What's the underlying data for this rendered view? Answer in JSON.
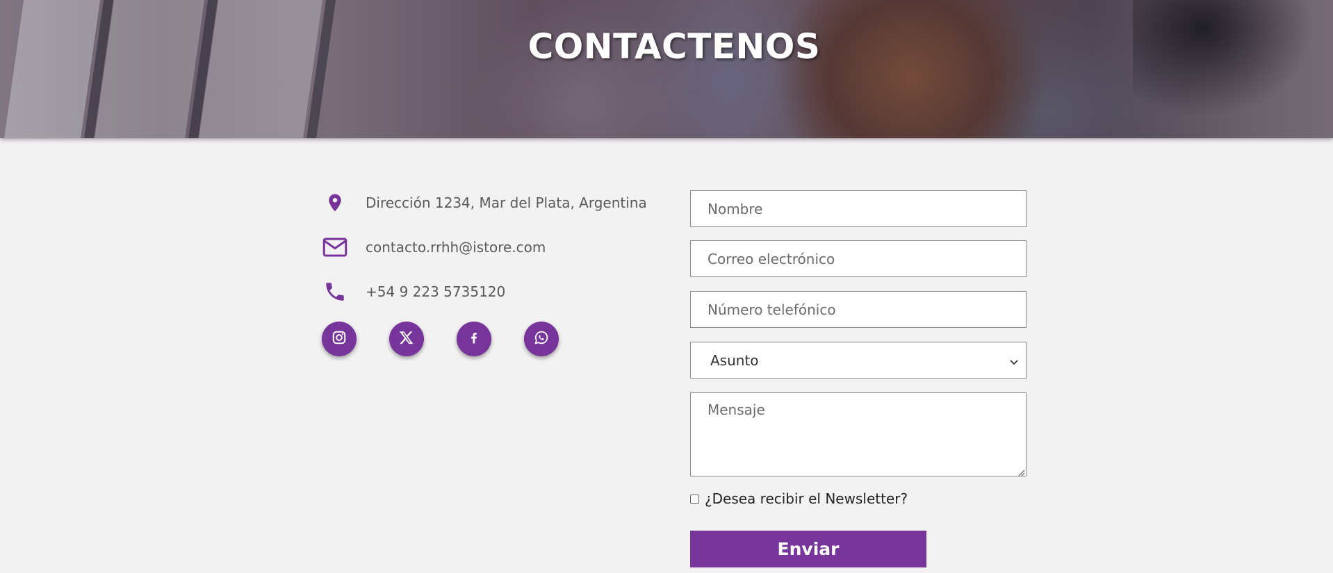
{
  "header": {
    "title": "CONTACTENOS"
  },
  "contact_info": {
    "address": {
      "icon": "location-pin-icon",
      "text": "Dirección 1234, Mar del Plata, Argentina"
    },
    "email": {
      "icon": "mail-icon",
      "text": "contacto.rrhh@istore.com"
    },
    "phone": {
      "icon": "phone-icon",
      "text": "+54 9 223 5735120"
    }
  },
  "social_links": [
    {
      "icon": "instagram-icon"
    },
    {
      "icon": "x-twitter-icon"
    },
    {
      "icon": "facebook-icon"
    },
    {
      "icon": "whatsapp-icon"
    }
  ],
  "form": {
    "name_placeholder": "Nombre",
    "email_placeholder": "Correo electrónico",
    "phone_placeholder": "Número telefónico",
    "subject_selected": "Asunto",
    "message_placeholder": "Mensaje",
    "newsletter_label": "¿Desea recibir el Newsletter?",
    "newsletter_checked": false,
    "submit_label": "Enviar"
  },
  "colors": {
    "accent": "#77349a",
    "background": "#f3f2f3",
    "header_text": "#ffffff"
  }
}
